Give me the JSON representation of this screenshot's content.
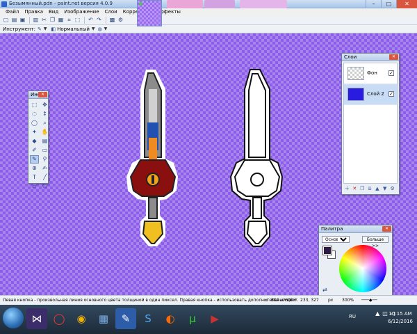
{
  "window": {
    "title": "Безымянный.pdn - paint.net версия 4.0.9",
    "minimize": "–",
    "maximize": "□",
    "close": "✕"
  },
  "menu": {
    "items": [
      {
        "label": "Файл"
      },
      {
        "label": "Правка"
      },
      {
        "label": "Вид"
      },
      {
        "label": "Изображение"
      },
      {
        "label": "Слои"
      },
      {
        "label": "Коррекция"
      },
      {
        "label": "Эффекты"
      }
    ]
  },
  "toolbar": {
    "icons": [
      "new-icon",
      "open-icon",
      "save-icon",
      "print-icon",
      "cut-icon",
      "copy-icon",
      "paste-icon",
      "crop-icon",
      "deselect-icon",
      "undo-icon",
      "redo-icon",
      "grid-icon",
      "settings-icon"
    ]
  },
  "options": {
    "tool_label": "Инструмент:",
    "blend_mode": "Нормальный"
  },
  "tools_window": {
    "title": "Инст..."
  },
  "layers_window": {
    "title": "Слои",
    "layers": [
      {
        "name": "Фон",
        "visible": true,
        "selected": false,
        "thumb_color": "#ffffff"
      },
      {
        "name": "Слой 2",
        "visible": true,
        "selected": true,
        "thumb_color": "#2a1be0"
      }
    ]
  },
  "palette_window": {
    "title": "Палитра",
    "mode": "Основной",
    "more_button": "Больше >>",
    "primary_color": "#2a1a44",
    "secondary_color": "#ffffff",
    "swatches": [
      "#000000",
      "#404040",
      "#ff0000",
      "#ff7f00",
      "#ffff00",
      "#00ff00",
      "#00ffff",
      "#0000ff",
      "#ff00ff",
      "#ffffff",
      "#800000",
      "#808000",
      "#008000",
      "#008080",
      "#000080",
      "#800080",
      "#c0c0c0",
      "#7f7f7f"
    ]
  },
  "status": {
    "hint": "Левая кнопка - произвольная линия основного цвета толщиной в один пиксел. Правая кнопка - использовать дополнительный цвет.",
    "size": "800 × 600",
    "position": "233, 327",
    "unit": "px",
    "zoom": "300%"
  },
  "taskbar": {
    "lang": "RU",
    "time": "10:15 AM",
    "date": "6/12/2016"
  },
  "colors": {
    "canvas_bg": "#7c4fd8",
    "accent": "#2a1be0"
  }
}
